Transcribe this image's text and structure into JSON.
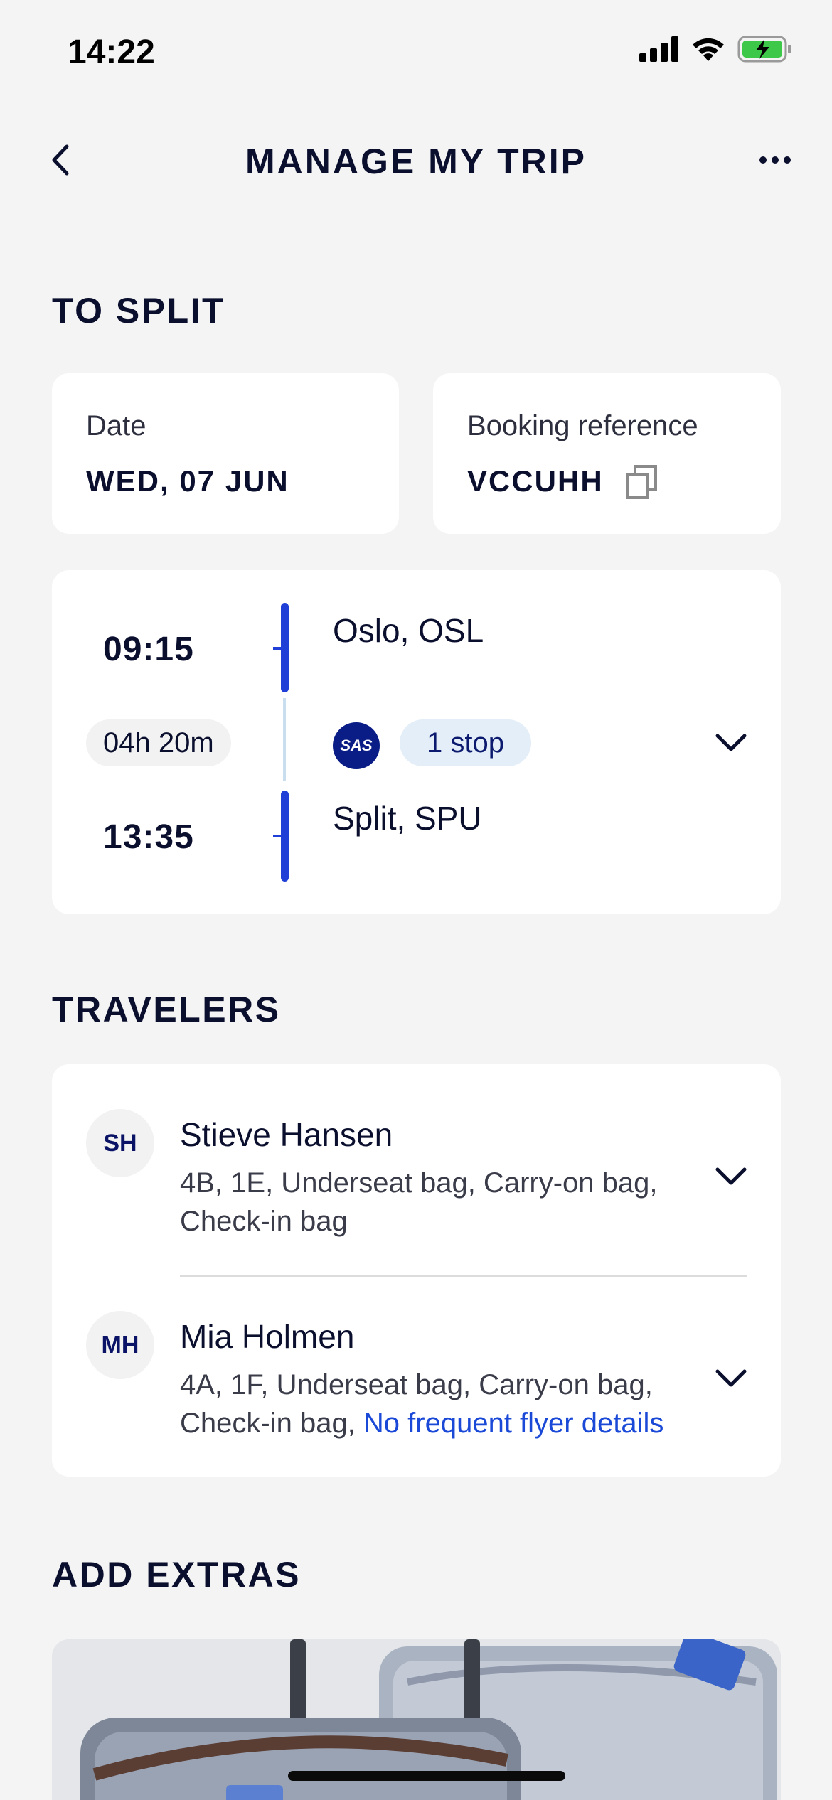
{
  "status_bar": {
    "time": "14:22"
  },
  "nav": {
    "title": "MANAGE MY TRIP"
  },
  "trip": {
    "heading": "TO SPLIT",
    "date_label": "Date",
    "date_value": "WED, 07 JUN",
    "booking_label": "Booking reference",
    "booking_value": "VCCUHH"
  },
  "flight": {
    "departure_time": "09:15",
    "arrival_time": "13:35",
    "duration": "04h 20m",
    "origin": "Oslo, OSL",
    "destination": "Split, SPU",
    "airline": "SAS",
    "stops": "1 stop"
  },
  "travelers": {
    "heading": "TRAVELERS",
    "items": [
      {
        "initials": "SH",
        "name": "Stieve Hansen",
        "details_line1": "4B, 1E, Underseat bag, Carry-on bag,",
        "details_line2": "Check-in bag",
        "link": ""
      },
      {
        "initials": "MH",
        "name": "Mia Holmen",
        "details_line1": "4A, 1F, Underseat bag, Carry-on bag,",
        "details_line2": "Check-in bag, ",
        "link": "No frequent flyer details"
      }
    ]
  },
  "extras": {
    "heading": "ADD EXTRAS"
  },
  "colors": {
    "accent": "#1f3fd6",
    "link": "#1a49d8",
    "background": "#f4f4f4",
    "brand_navy": "#0a1d86"
  }
}
